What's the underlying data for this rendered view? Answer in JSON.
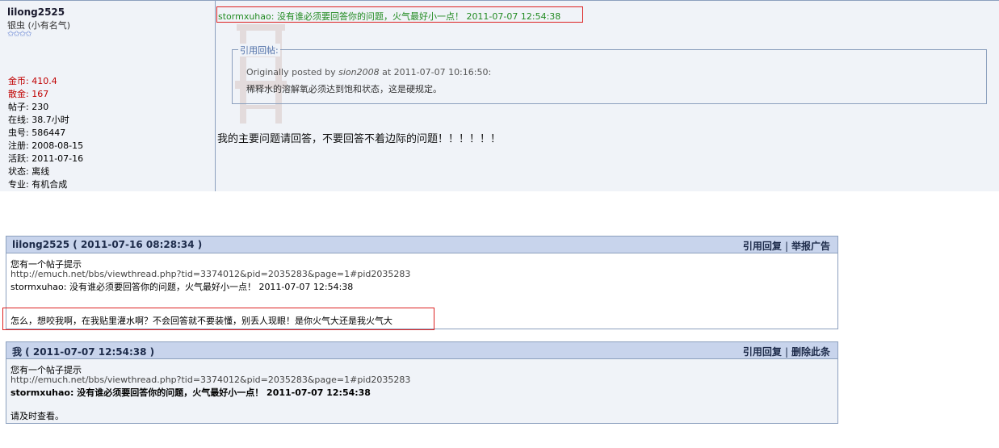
{
  "post": {
    "user": {
      "name": "lilong2525",
      "rank": "银虫 (小有名气)",
      "stars": "✩✩✩✩",
      "stats": [
        {
          "label": "金币: 410.4",
          "color": "red"
        },
        {
          "label": "散金: 167",
          "color": "red"
        },
        {
          "label": "帖子: 230",
          "color": "normal"
        },
        {
          "label": "在线: 38.7小时",
          "color": "normal"
        },
        {
          "label": "虫号: 586447",
          "color": "normal"
        },
        {
          "label": "注册: 2008-08-15",
          "color": "normal"
        },
        {
          "label": "活跃: 2011-07-16",
          "color": "normal"
        },
        {
          "label": "状态: 离线",
          "color": "normal"
        },
        {
          "label": "专业: 有机合成",
          "color": "normal"
        }
      ]
    },
    "highlight": "stormxuhao: 没有谁必须要回答你的问题，火气最好小一点！ 2011-07-07 12:54:38",
    "quote": {
      "legend": "引用回帖:",
      "posted_prefix": "Originally posted by ",
      "posted_author": "sion2008",
      "posted_suffix": " at 2011-07-07 10:16:50:",
      "text": "稀释水的溶解氧必须达到饱和状态，这是硬规定。"
    },
    "message": "我的主要问题请回答，不要回答不着边际的问题！！！！！！"
  },
  "messages": [
    {
      "title": "lilong2525 ( 2011-07-16 08:28:34 )",
      "actions": [
        "引用回复",
        "举报广告"
      ],
      "lines": [
        "您有一个帖子提示",
        "http://emuch.net/bbs/viewthread.php?tid=3374012&pid=2035283&page=1#pid2035283",
        "stormxuhao: 没有谁必须要回答你的问题，火气最好小一点！ 2011-07-07 12:54:38",
        "怎么，想咬我啊，在我贴里灌水啊？不会回答就不要装懂，别丢人现眼！是你火气大还是我火气大"
      ]
    },
    {
      "title": "我 ( 2011-07-07 12:54:38 )",
      "actions": [
        "引用回复",
        "删除此条"
      ],
      "lines": [
        "您有一个帖子提示",
        "http://emuch.net/bbs/viewthread.php?tid=3374012&pid=2035283&page=1#pid2035283",
        "stormxuhao: 没有谁必须要回答你的问题，火气最好小一点！ 2011-07-07 12:54:38",
        "请及时查看。"
      ]
    }
  ],
  "colors": {
    "highlight_border": "#dd2222",
    "highlight_text": "#228b22",
    "header_bg": "#c8d4ec",
    "post_bg": "#f0f3f8"
  }
}
